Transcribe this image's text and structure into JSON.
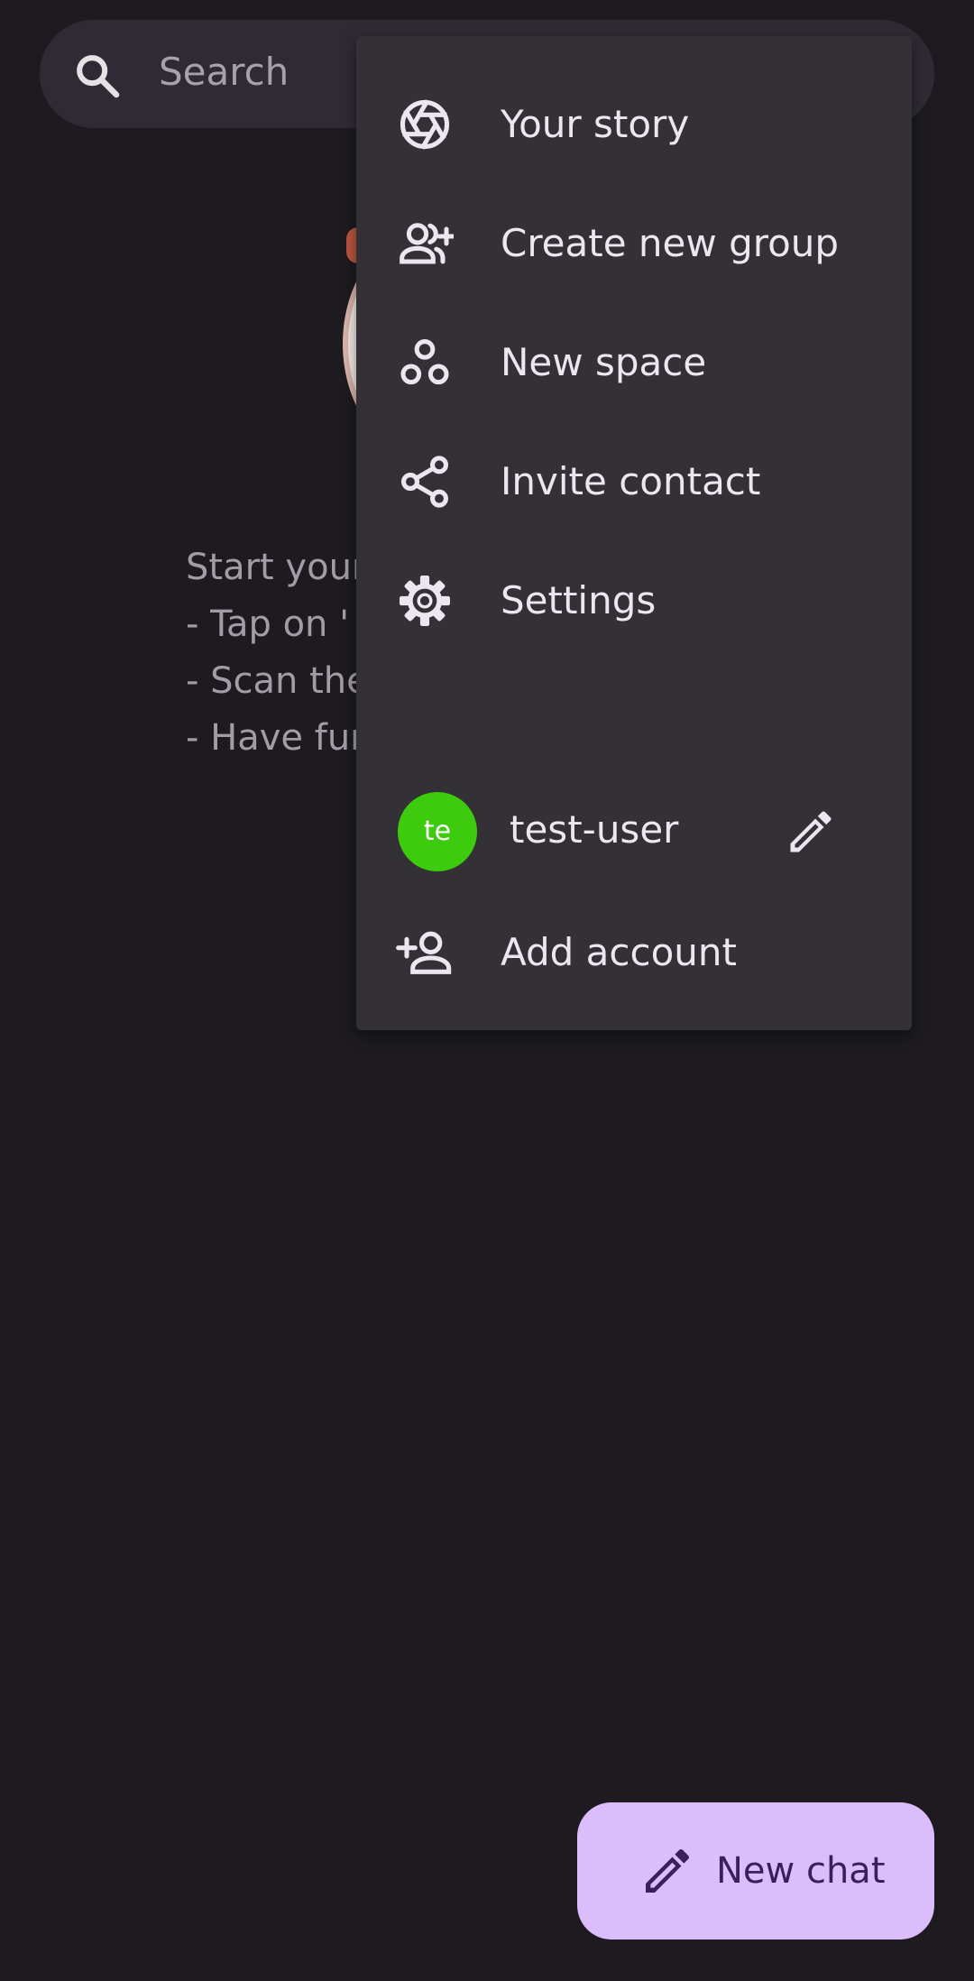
{
  "search": {
    "placeholder": "Search"
  },
  "intro": {
    "lines": [
      "Start your",
      "- Tap on '",
      "- Scan the",
      "- Have fun"
    ]
  },
  "menu": {
    "items": [
      {
        "label": "Your story",
        "icon": "aperture-icon"
      },
      {
        "label": "Create new group",
        "icon": "group-add-icon"
      },
      {
        "label": "New space",
        "icon": "workspaces-icon"
      },
      {
        "label": "Invite contact",
        "icon": "share-icon"
      },
      {
        "label": "Settings",
        "icon": "gear-icon"
      }
    ],
    "account": {
      "avatar_initials": "te",
      "avatar_color": "#3dcb0e",
      "name": "test-user"
    },
    "add_account_label": "Add account"
  },
  "fab": {
    "label": "New chat"
  },
  "colors": {
    "background": "#1d1b20",
    "menu_surface": "#333136",
    "fab_container": "#dcbdfb",
    "fab_content": "#3a1f5c"
  }
}
